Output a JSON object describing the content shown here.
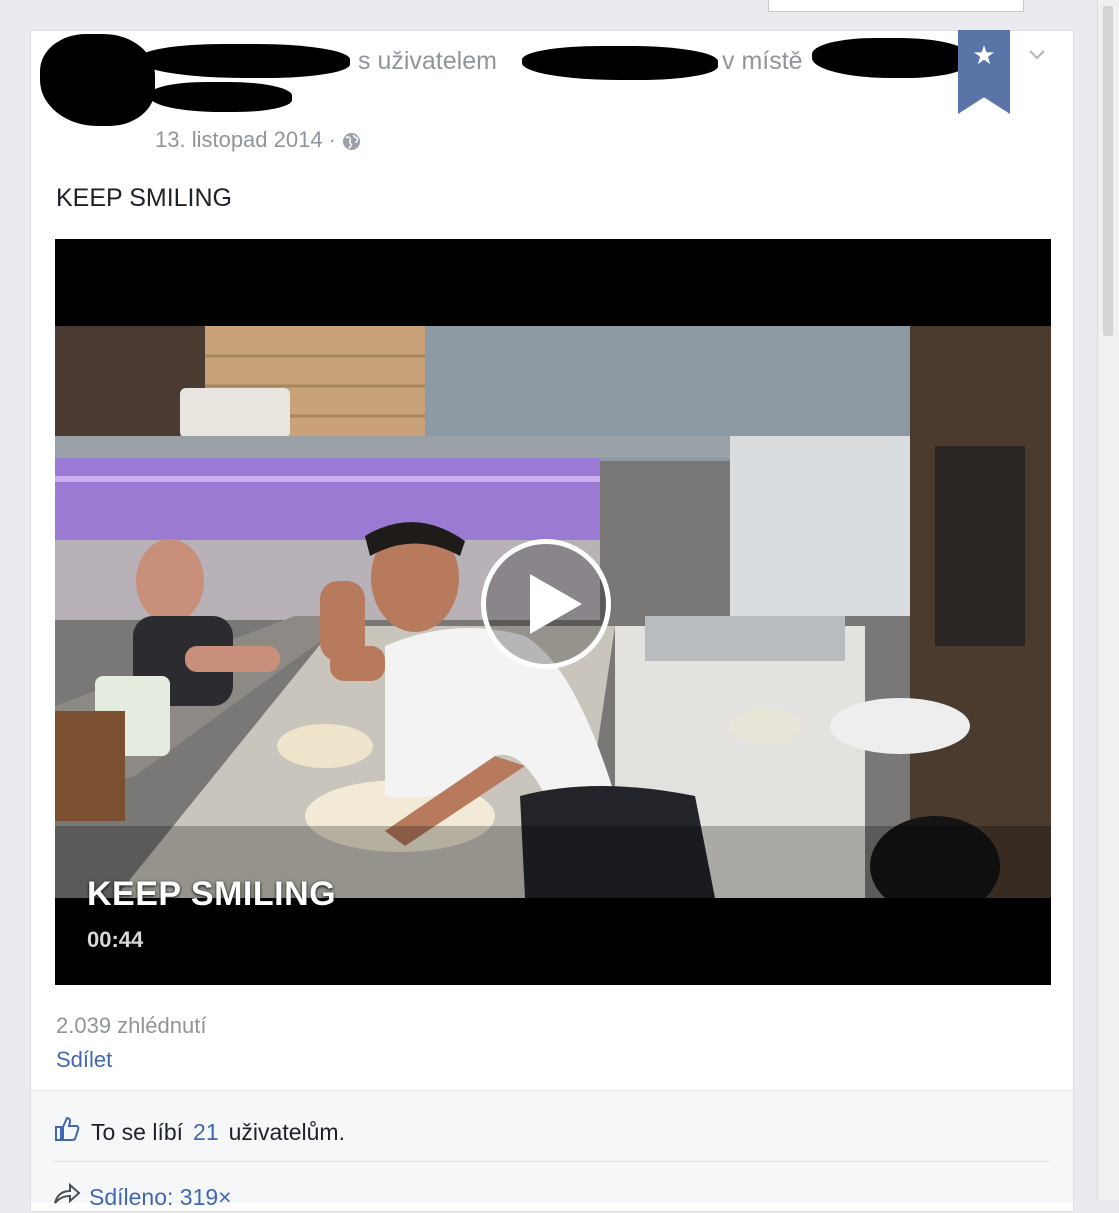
{
  "post": {
    "header_with": "s uživatelem",
    "header_at": "v místě",
    "date": "13. listopad 2014",
    "date_separator": "·",
    "status_text": "KEEP SMILING",
    "bookmark_icon": "star-icon",
    "menu_icon": "chevron-down-icon"
  },
  "video": {
    "title": "KEEP SMILING",
    "duration": "00:44",
    "play_icon": "play-icon",
    "views": "2.039 zhlédnutí",
    "share_label": "Sdílet"
  },
  "footer": {
    "likes_prefix": "To se líbí",
    "likes_count": "21",
    "likes_suffix": "uživatelům.",
    "shares_label": "Sdíleno: 319×"
  },
  "colors": {
    "link": "#4267b2",
    "muted": "#90949c",
    "bookmark": "#5b74a8"
  }
}
